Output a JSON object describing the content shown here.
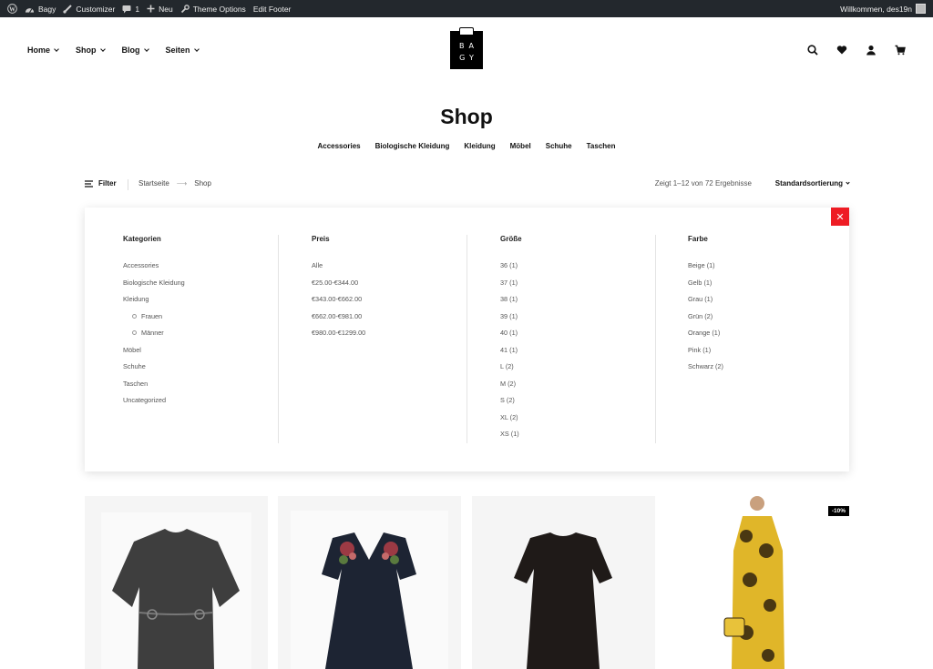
{
  "admin_bar": {
    "site_name": "Bagy",
    "customizer": "Customizer",
    "comments_count": "1",
    "new_label": "Neu",
    "theme_options": "Theme Options",
    "edit_footer": "Edit Footer",
    "greeting": "Willkommen, des19n"
  },
  "header": {
    "nav": [
      "Home",
      "Shop",
      "Blog",
      "Seiten"
    ],
    "logo_line1": "BA",
    "logo_line2": "GY"
  },
  "page": {
    "title": "Shop",
    "categories": [
      "Accessories",
      "Biologische Kleidung",
      "Kleidung",
      "Möbel",
      "Schuhe",
      "Taschen"
    ]
  },
  "toolbar": {
    "filter_label": "Filter",
    "breadcrumb_home": "Startseite",
    "breadcrumb_arrow": "⟶",
    "breadcrumb_current": "Shop",
    "result_count": "Zeigt 1–12 von 72 Ergebnisse",
    "sort_label": "Standardsortierung"
  },
  "filters": {
    "close_symbol": "✕",
    "categories": {
      "title": "Kategorien",
      "items": [
        "Accessories",
        "Biologische Kleidung",
        "Kleidung"
      ],
      "subitems": [
        "Frauen",
        "Männer"
      ],
      "items_after": [
        "Möbel",
        "Schuhe",
        "Taschen",
        "Uncategorized"
      ]
    },
    "price": {
      "title": "Preis",
      "items": [
        "Alle",
        "€25.00-€344.00",
        "€343.00-€662.00",
        "€662.00-€981.00",
        "€980.00-€1299.00"
      ]
    },
    "size": {
      "title": "Größe",
      "items": [
        "36 (1)",
        "37 (1)",
        "38 (1)",
        "39 (1)",
        "40 (1)",
        "41 (1)",
        "L (2)",
        "M (2)",
        "S (2)",
        "XL (2)",
        "XS (1)"
      ]
    },
    "color": {
      "title": "Farbe",
      "items": [
        "Beige (1)",
        "Gelb (1)",
        "Grau (1)",
        "Grün (2)",
        "Orange (1)",
        "Pink (1)",
        "Schwarz (2)"
      ]
    }
  },
  "products": [
    {
      "badge": ""
    },
    {
      "badge": ""
    },
    {
      "badge": ""
    },
    {
      "badge": "-10%"
    }
  ],
  "colors": {
    "admin_bar_bg": "#23282d",
    "close_button": "#ee1c24"
  }
}
